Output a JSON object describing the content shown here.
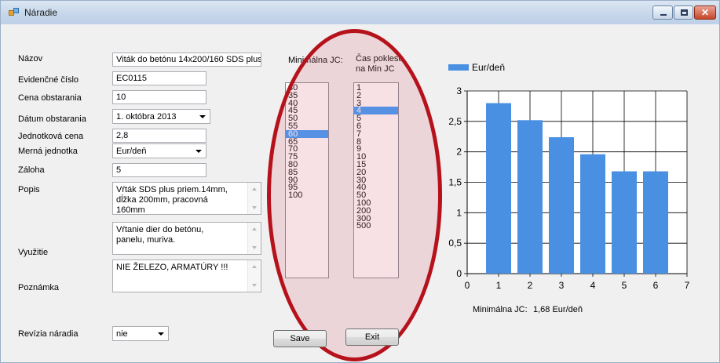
{
  "window": {
    "title": "Náradie"
  },
  "form": {
    "nazov": {
      "label": "Názov",
      "value": "Viták do betónu 14x200/160 SDS plus"
    },
    "evidencne": {
      "label": "Evidenčné číslo",
      "value": "EC0115"
    },
    "cena": {
      "label": "Cena obstarania",
      "value": "10"
    },
    "datum": {
      "label": "Dátum obstarania",
      "value": "1.  októbra  2013"
    },
    "jednotkova": {
      "label": "Jednotková cena",
      "value": "2,8"
    },
    "merna": {
      "label": "Merná jednotka",
      "value": "Eur/deň"
    },
    "zaloha": {
      "label": "Záloha",
      "value": "5"
    },
    "popis": {
      "label": "Popis",
      "value": "Vŕták SDS plus priem.14mm, dĺžka 200mm, pracovná 160mm"
    },
    "vyuzitie": {
      "label": "Využitie",
      "value": "Vŕtanie dier do betónu, panelu, muriva."
    },
    "poznamka": {
      "label": "Poznámka",
      "value": "NIE ŽELEZO, ARMATÚRY !!!"
    },
    "revizia": {
      "label": "Revízia náradia",
      "value": "nie"
    }
  },
  "lists": {
    "min_jc": {
      "header": "Minimálna JC:",
      "items": [
        "30",
        "35",
        "40",
        "45",
        "50",
        "55",
        "60",
        "65",
        "70",
        "75",
        "80",
        "85",
        "90",
        "95",
        "100"
      ],
      "selected": "60"
    },
    "cas": {
      "header_line1": "Čas poklesu",
      "header_line2": "na Min JC",
      "items": [
        "1",
        "2",
        "3",
        "4",
        "5",
        "6",
        "7",
        "8",
        "9",
        "10",
        "15",
        "20",
        "30",
        "40",
        "50",
        "100",
        "200",
        "300",
        "500"
      ],
      "selected": "4"
    }
  },
  "buttons": {
    "save": "Save",
    "exit": "Exit"
  },
  "summary": {
    "label": "Minimálna JC:",
    "value": "1,68 Eur/deň"
  },
  "colors": {
    "bar": "#4a90e2",
    "annotation": "#b5121b"
  },
  "chart_data": {
    "type": "bar",
    "x": [
      1,
      2,
      3,
      4,
      5,
      6
    ],
    "values": [
      2.8,
      2.52,
      2.24,
      1.96,
      1.68,
      1.68
    ],
    "series": [
      {
        "name": "Eur/deň",
        "values": [
          2.8,
          2.52,
          2.24,
          1.96,
          1.68,
          1.68
        ]
      }
    ],
    "xlim": [
      0,
      7
    ],
    "ylim": [
      0,
      3
    ],
    "xticks": [
      "0",
      "1",
      "2",
      "3",
      "4",
      "5",
      "6",
      "7"
    ],
    "yticks": [
      "0",
      "0,5",
      "1",
      "1,5",
      "2",
      "2,5",
      "3"
    ],
    "grid": true,
    "legend": "top-left"
  }
}
